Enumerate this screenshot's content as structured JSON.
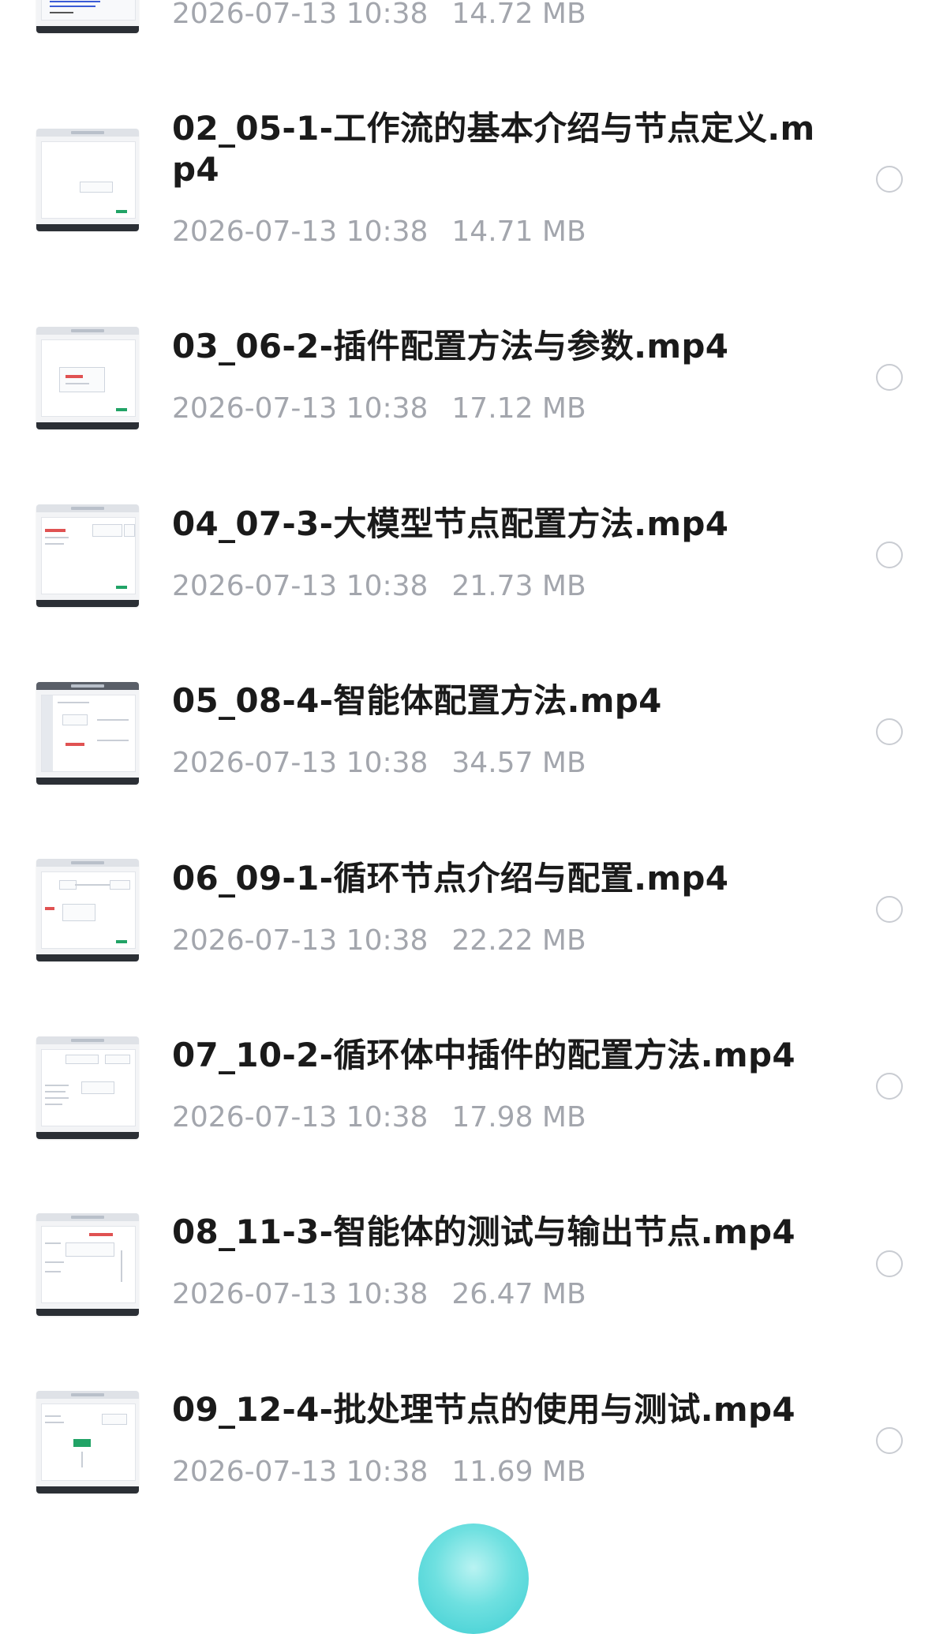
{
  "files": [
    {
      "name": "",
      "date": "2026-07-13 10:38",
      "size": "14.72 MB"
    },
    {
      "name": "02_05-1-工作流的基本介绍与节点定义.mp4",
      "date": "2026-07-13 10:38",
      "size": "14.71 MB"
    },
    {
      "name": "03_06-2-插件配置方法与参数.mp4",
      "date": "2026-07-13 10:38",
      "size": "17.12 MB"
    },
    {
      "name": "04_07-3-大模型节点配置方法.mp4",
      "date": "2026-07-13 10:38",
      "size": "21.73 MB"
    },
    {
      "name": "05_08-4-智能体配置方法.mp4",
      "date": "2026-07-13 10:38",
      "size": "34.57 MB"
    },
    {
      "name": "06_09-1-循环节点介绍与配置.mp4",
      "date": "2026-07-13 10:38",
      "size": "22.22 MB"
    },
    {
      "name": "07_10-2-循环体中插件的配置方法.mp4",
      "date": "2026-07-13 10:38",
      "size": "17.98 MB"
    },
    {
      "name": "08_11-3-智能体的测试与输出节点.mp4",
      "date": "2026-07-13 10:38",
      "size": "26.47 MB"
    },
    {
      "name": "09_12-4-批处理节点的使用与测试.mp4",
      "date": "2026-07-13 10:38",
      "size": "11.69 MB"
    }
  ],
  "icons": {
    "thumbnail": "video-thumbnail",
    "select": "radio-unchecked-icon",
    "fab": "upload-fab-icon"
  },
  "colors": {
    "title": "#1a1a1a",
    "meta": "#a3a6ad",
    "radio_border": "#c9ccd2",
    "fab": "#3ccdd2"
  }
}
